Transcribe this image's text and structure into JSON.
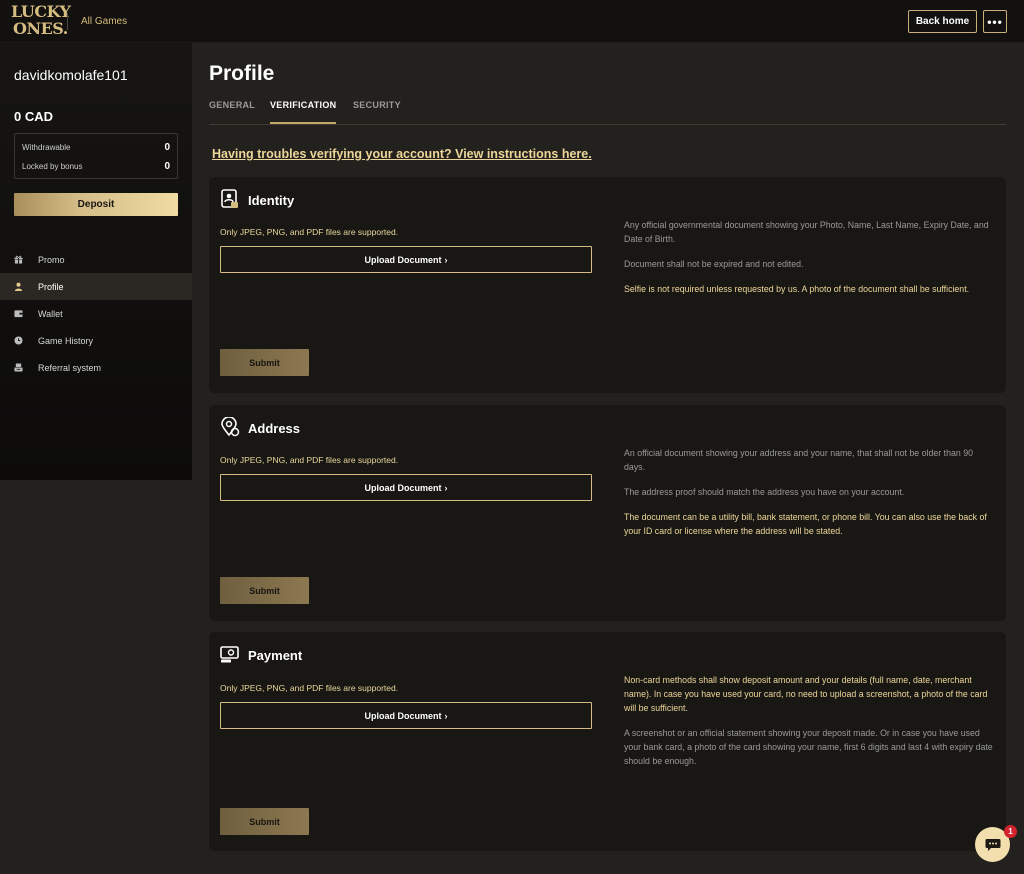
{
  "header": {
    "logo_line1": "LUCKY",
    "logo_line2": "ONES.",
    "all_games": "All Games",
    "back_home": "Back home",
    "more": "•••"
  },
  "sidebar": {
    "username": "davidkomolafe101",
    "balance": "0  CAD",
    "withdrawable_label": "Withdrawable",
    "withdrawable_value": "0",
    "locked_label": "Locked by bonus",
    "locked_value": "0",
    "deposit": "Deposit",
    "items": [
      {
        "label": "Promo",
        "icon": "gift-icon"
      },
      {
        "label": "Profile",
        "icon": "user-icon",
        "active": true
      },
      {
        "label": "Wallet",
        "icon": "wallet-icon"
      },
      {
        "label": "Game History",
        "icon": "clock-icon"
      },
      {
        "label": "Referral system",
        "icon": "referral-icon"
      }
    ]
  },
  "main": {
    "title": "Profile",
    "tabs": [
      "GENERAL",
      "VERIFICATION",
      "SECURITY"
    ],
    "active_tab": "VERIFICATION",
    "help_link": "Having troubles verifying your account? View instructions here.",
    "cards": [
      {
        "title": "Identity",
        "icon": "id-card-icon",
        "supported": "Only JPEG, PNG, and PDF files are supported.",
        "upload": "Upload Document",
        "submit": "Submit",
        "notes": [
          {
            "text": "Any official governmental document showing your Photo, Name, Last Name, Expiry Date, and Date of Birth.",
            "tone": "grey"
          },
          {
            "text": "Document shall not be expired and not edited.",
            "tone": "grey"
          },
          {
            "text": "Selfie is not required unless requested by us. A photo of the document shall be sufficient.",
            "tone": "gold"
          }
        ]
      },
      {
        "title": "Address",
        "icon": "location-pin-icon",
        "supported": "Only JPEG, PNG, and PDF files are supported.",
        "upload": "Upload Document",
        "submit": "Submit",
        "notes": [
          {
            "text": "An official document showing your address and your name, that shall not be older than 90 days.",
            "tone": "grey"
          },
          {
            "text": "The address proof should match the address you have on your account.",
            "tone": "grey"
          },
          {
            "text": "The document can be a utility bill, bank statement, or phone bill. You can also use the back of your ID card or license where the address will be stated.",
            "tone": "gold"
          }
        ]
      },
      {
        "title": "Payment",
        "icon": "payment-card-icon",
        "supported": "Only JPEG, PNG, and PDF files are supported.",
        "upload": "Upload Document",
        "submit": "Submit",
        "notes": [
          {
            "text": "Non-card methods shall show deposit amount and your details (full name, date, merchant name). In case you have used your card, no need to upload a screenshot, a photo of the card will be sufficient.",
            "tone": "gold"
          },
          {
            "text": "A screenshot or an official statement showing your deposit made. Or in case you have used your bank card, a photo of the card showing your name, first 6 digits and last 4 with expiry date should be enough.",
            "tone": "grey"
          }
        ]
      }
    ]
  },
  "chat": {
    "badge": "1"
  },
  "colors": {
    "accent_gold": "#d5bc80",
    "background": "#23211d",
    "card": "#191714",
    "badge": "#d3232f"
  }
}
